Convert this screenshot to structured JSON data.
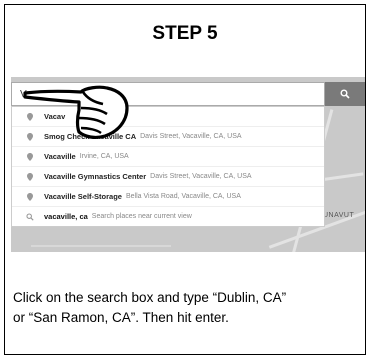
{
  "step": {
    "title": "STEP 5"
  },
  "search": {
    "value": "Vacav",
    "button_icon": "search-icon"
  },
  "suggestions": [
    {
      "icon": "pin-icon",
      "name": "Vacav",
      "detail": ""
    },
    {
      "icon": "pin-icon",
      "name": "Smog Check Vacaville CA",
      "detail": "Davis Street, Vacaville, CA, USA"
    },
    {
      "icon": "pin-icon",
      "name": "Vacaville",
      "detail": "Irvine, CA, USA"
    },
    {
      "icon": "pin-icon",
      "name": "Vacaville Gymnastics Center",
      "detail": "Davis Street, Vacaville, CA, USA"
    },
    {
      "icon": "pin-icon",
      "name": "Vacaville Self-Storage",
      "detail": "Bella Vista Road, Vacaville, CA, USA"
    },
    {
      "icon": "search-icon",
      "name": "vacaville, ca",
      "detail": "Search places near current view"
    }
  ],
  "map": {
    "label": "UNAVUT"
  },
  "instruction": {
    "line1": "Click on the search box and type “Dublin, CA”",
    "line2": "or “San Ramon, CA”.  Then hit enter."
  },
  "colors": {
    "button": "#7a7a7a",
    "map": "#c9c9c9"
  }
}
